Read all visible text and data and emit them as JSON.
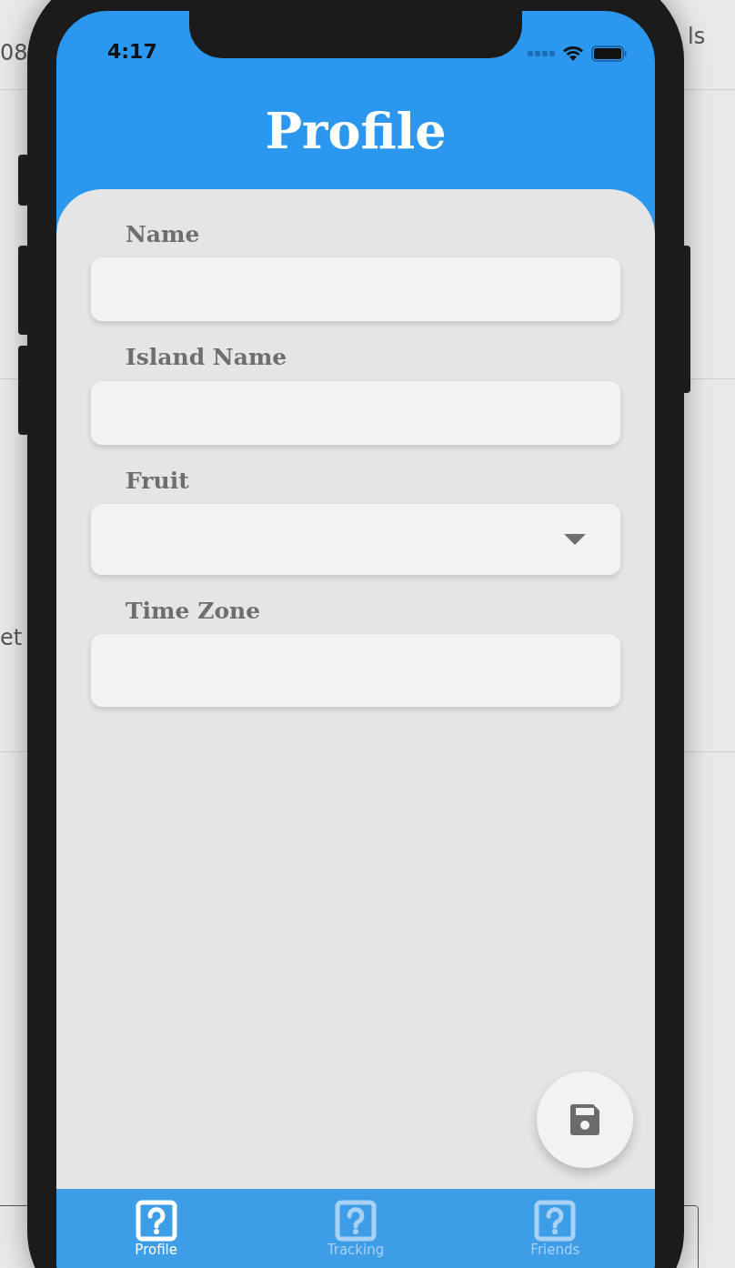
{
  "background_fragments": [
    {
      "text": "08"
    },
    {
      "text": "ls"
    },
    {
      "text": "et"
    }
  ],
  "status_bar": {
    "time": "4:17"
  },
  "title": "Profile",
  "fields": [
    {
      "label": "Name",
      "kind": "text"
    },
    {
      "label": "Island Name",
      "kind": "text"
    },
    {
      "label": "Fruit",
      "kind": "dropdown"
    },
    {
      "label": "Time Zone",
      "kind": "text"
    }
  ],
  "tabs": [
    {
      "label": "Profile",
      "selected": true
    },
    {
      "label": "Tracking",
      "selected": false
    },
    {
      "label": "Friends",
      "selected": false
    }
  ]
}
